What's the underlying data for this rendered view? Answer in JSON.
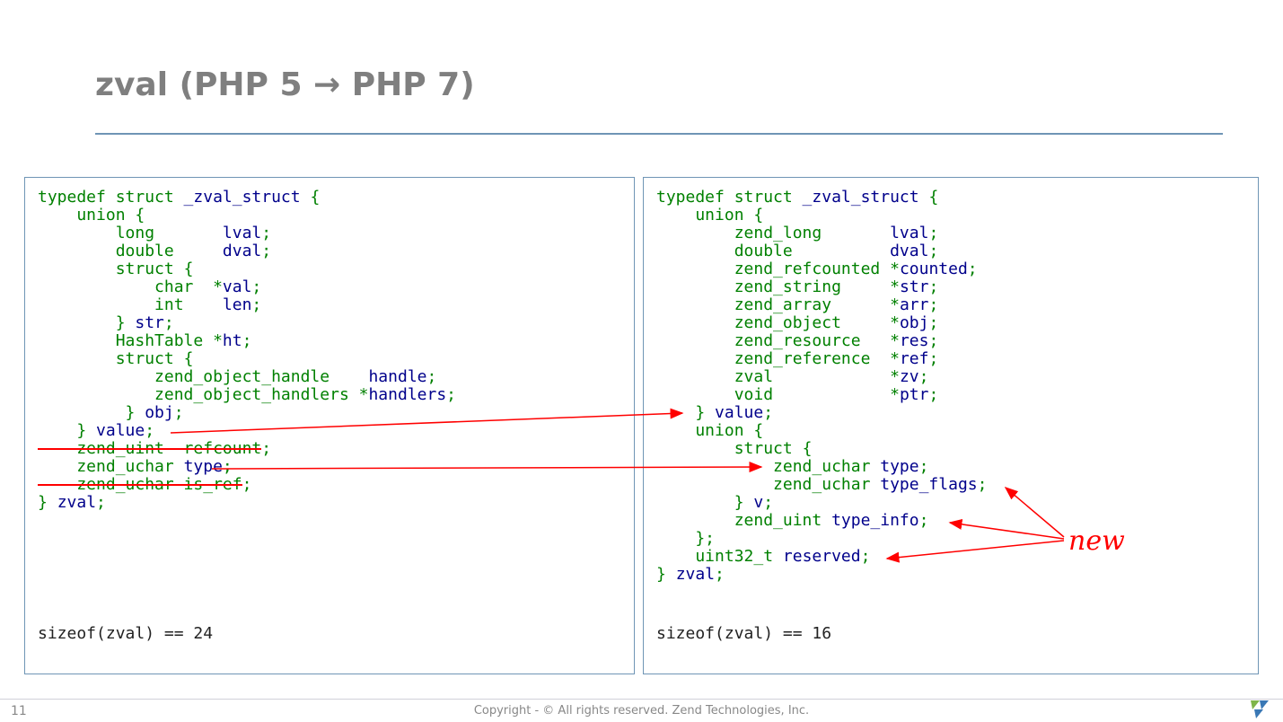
{
  "title": "zval (PHP 5 → PHP 7)",
  "pagenum": "11",
  "copyright": "Copyright - © All rights reserved. Zend Technologies, Inc.",
  "newLabel": "new",
  "php5": {
    "sizeof": "sizeof(zval) == 24",
    "l1a": "typedef",
    "l1b": " struct",
    "l1c": " _zval_struct ",
    "l1d": "{",
    "l2a": "    union ",
    "l2b": "{",
    "l3a": "        long",
    "l3b": "       lval",
    "l3c": ";",
    "l4a": "        double",
    "l4b": "     dval",
    "l4c": ";",
    "l5a": "        struct ",
    "l5b": "{",
    "l6a": "            char",
    "l6b": "  *",
    "l6c": "val",
    "l6d": ";",
    "l7a": "            int",
    "l7b": "    len",
    "l7c": ";",
    "l8a": "        } ",
    "l8b": "str",
    "l8c": ";",
    "l9a": "        HashTable ",
    "l9b": "*",
    "l9c": "ht",
    "l9d": ";",
    "l10a": "        struct ",
    "l10b": "{",
    "l11a": "            zend_object_handle    ",
    "l11b": "handle",
    "l11c": ";",
    "l12a": "            zend_object_handlers ",
    "l12b": "*",
    "l12c": "handlers",
    "l12d": ";",
    "l13a": "         } ",
    "l13b": "obj",
    "l13c": ";",
    "l14a": "    } ",
    "l14b": "value",
    "l14c": ";",
    "l15a": "    zend_uint  refcount",
    "l15b": ";",
    "l16a": "    zend_uchar ",
    "l16b": "type",
    "l16c": ";",
    "l17a": "    zend_uchar is_ref",
    "l17b": ";",
    "l18a": "} ",
    "l18b": "zval",
    "l18c": ";"
  },
  "php7": {
    "sizeof": "sizeof(zval) == 16",
    "l1a": "typedef",
    "l1b": " struct",
    "l1c": " _zval_struct ",
    "l1d": "{",
    "l2a": "    union ",
    "l2b": "{",
    "l3a": "        zend_long       ",
    "l3b": "lval",
    "l3c": ";",
    "l4a": "        double",
    "l4b": "          dval",
    "l4c": ";",
    "l5a": "        zend_refcounted ",
    "l5b": "*",
    "l5c": "counted",
    "l5d": ";",
    "l6a": "        zend_string     ",
    "l6b": "*",
    "l6c": "str",
    "l6d": ";",
    "l7a": "        zend_array      ",
    "l7b": "*",
    "l7c": "arr",
    "l7d": ";",
    "l8a": "        zend_object     ",
    "l8b": "*",
    "l8c": "obj",
    "l8d": ";",
    "l9a": "        zend_resource   ",
    "l9b": "*",
    "l9c": "res",
    "l9d": ";",
    "l10a": "        zend_reference  ",
    "l10b": "*",
    "l10c": "ref",
    "l10d": ";",
    "l11a": "        zval            ",
    "l11b": "*",
    "l11c": "zv",
    "l11d": ";",
    "l12a": "        void",
    "l12b": "            *",
    "l12c": "ptr",
    "l12d": ";",
    "l13a": "    } ",
    "l13b": "value",
    "l13c": ";",
    "l14a": "    union ",
    "l14b": "{",
    "l15a": "        struct ",
    "l15b": "{",
    "l16a": "            zend_uchar ",
    "l16b": "type",
    "l16c": ";",
    "l17a": "            zend_uchar ",
    "l17b": "type_flags",
    "l17c": ";",
    "l18a": "        } ",
    "l18b": "v",
    "l18c": ";",
    "l19a": "        zend_uint ",
    "l19b": "type_info",
    "l19c": ";",
    "l20a": "    };",
    "l21a": "    uint32_t ",
    "l21b": "reserved",
    "l21c": ";",
    "l22a": "} ",
    "l22b": "zval",
    "l22c": ";"
  }
}
